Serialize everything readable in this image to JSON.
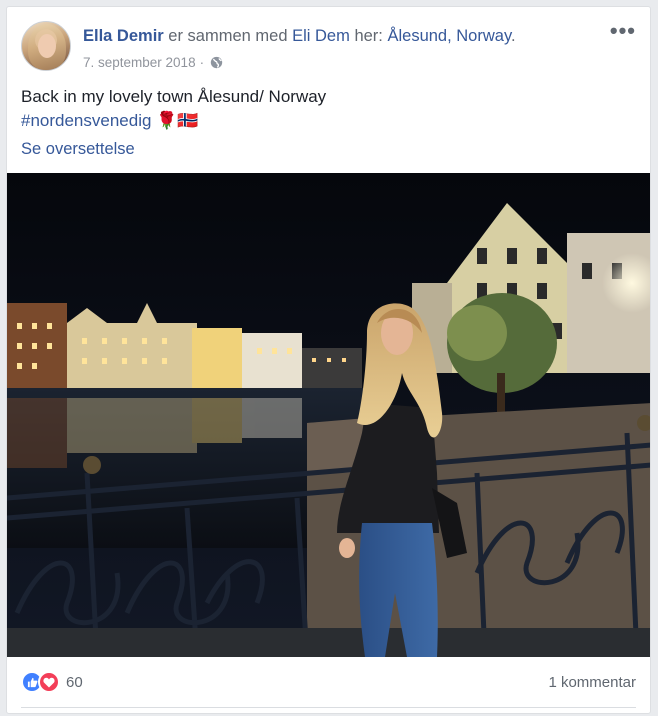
{
  "post": {
    "author": "Ella Demir",
    "with_text": " er sammen med ",
    "tagged": "Eli Dem",
    "here_text": " her: ",
    "place": "Ålesund, Norway",
    "period": ".",
    "date": "7. september 2018",
    "separator": "·",
    "privacy_icon": "globe-icon",
    "more_icon": "more-options-icon",
    "more_glyph": "•••",
    "body_line1": "Back in my lovely town Ålesund/ Norway",
    "hashtag": "#nordensvenedig",
    "emoji": "🌹🇳🇴",
    "translate": "Se oversettelse"
  },
  "photo": {
    "description_icon": "post-photo"
  },
  "footer": {
    "reaction_icons": [
      "like-icon",
      "love-icon"
    ],
    "reaction_count": "60",
    "comment_count": "1 kommentar"
  }
}
